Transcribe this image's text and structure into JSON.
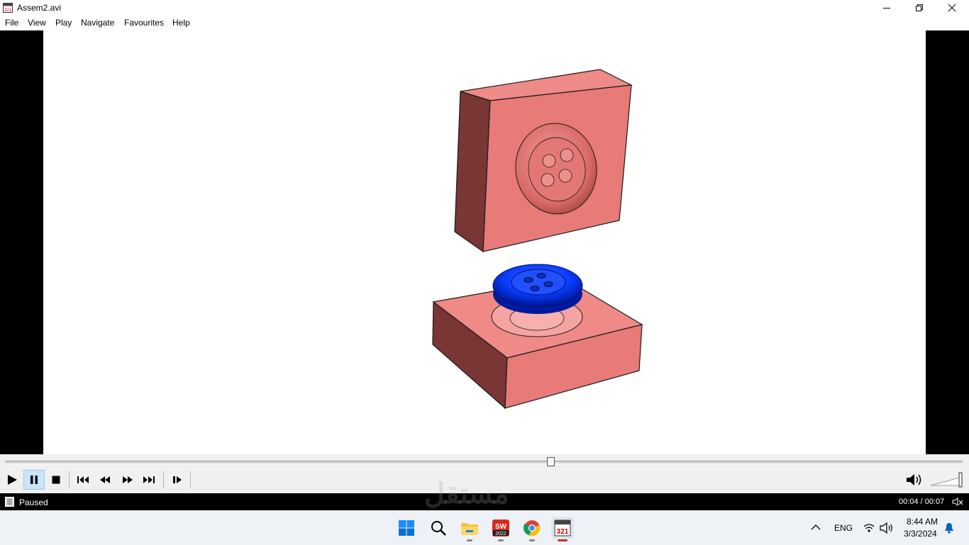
{
  "window": {
    "title": "Assem2.avi"
  },
  "menu": {
    "items": [
      "File",
      "View",
      "Play",
      "Navigate",
      "Favourites",
      "Help"
    ]
  },
  "playback": {
    "position_fraction": 0.57
  },
  "status": {
    "state": "Paused",
    "time": "00:04 / 00:07"
  },
  "watermark": {
    "text": "مستقل"
  },
  "taskbar": {
    "lang": "ENG",
    "clock_time": "8:44 AM",
    "clock_date": "3/3/2024",
    "sw_label": "2022",
    "app_label": "321"
  },
  "colors": {
    "mold": "#e87a78",
    "mold_dark": "#7a3535",
    "button": "#0a3cff",
    "accent": "#0067c0"
  }
}
